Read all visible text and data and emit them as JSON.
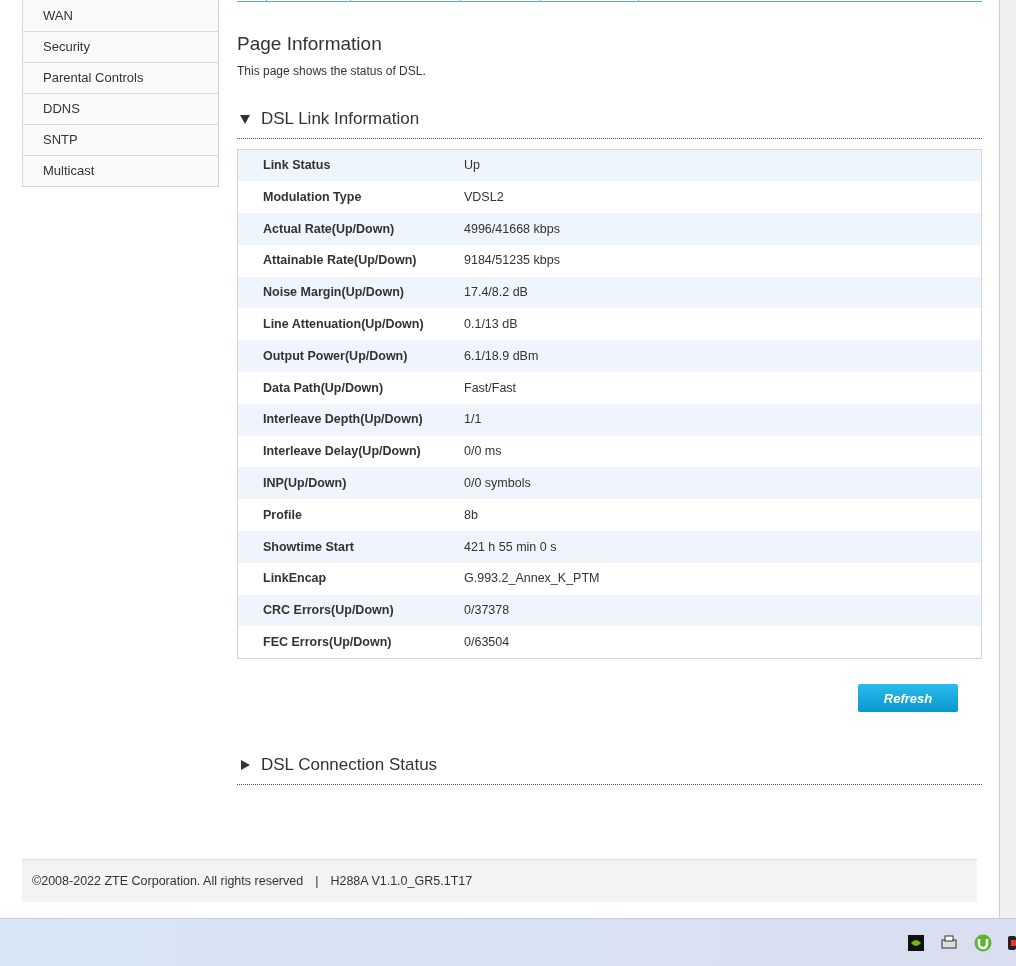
{
  "sidebar": {
    "items": [
      {
        "label": "WAN"
      },
      {
        "label": "Security"
      },
      {
        "label": "Parental Controls"
      },
      {
        "label": "DDNS"
      },
      {
        "label": "SNTP"
      },
      {
        "label": "Multicast"
      }
    ]
  },
  "page": {
    "title": "Page Information",
    "description": "This page shows the status of DSL."
  },
  "sections": [
    {
      "title": "DSL Link Information",
      "expanded": true,
      "rows": [
        {
          "label": "Link Status",
          "value": "Up"
        },
        {
          "label": "Modulation Type",
          "value": "VDSL2"
        },
        {
          "label": "Actual Rate(Up/Down)",
          "value": "4996/41668 kbps"
        },
        {
          "label": "Attainable Rate(Up/Down)",
          "value": "9184/51235 kbps"
        },
        {
          "label": "Noise Margin(Up/Down)",
          "value": "17.4/8.2 dB"
        },
        {
          "label": "Line Attenuation(Up/Down)",
          "value": "0.1/13 dB"
        },
        {
          "label": "Output Power(Up/Down)",
          "value": "6.1/18.9 dBm"
        },
        {
          "label": "Data Path(Up/Down)",
          "value": "Fast/Fast"
        },
        {
          "label": "Interleave Depth(Up/Down)",
          "value": "1/1"
        },
        {
          "label": "Interleave Delay(Up/Down)",
          "value": "0/0 ms"
        },
        {
          "label": "INP(Up/Down)",
          "value": "0/0 symbols"
        },
        {
          "label": "Profile",
          "value": "8b"
        },
        {
          "label": "Showtime Start",
          "value": "421 h 55 min 0 s"
        },
        {
          "label": "LinkEncap",
          "value": "G.993.2_Annex_K_PTM"
        },
        {
          "label": "CRC Errors(Up/Down)",
          "value": "0/37378"
        },
        {
          "label": "FEC Errors(Up/Down)",
          "value": "0/63504"
        }
      ],
      "button": "Refresh"
    },
    {
      "title": "DSL Connection Status",
      "expanded": false
    }
  ],
  "footer": {
    "copyright": "©2008-2022 ZTE Corporation. All rights reserved",
    "separator": "|",
    "version": "H288A V1.1.0_GR5.1T17"
  }
}
